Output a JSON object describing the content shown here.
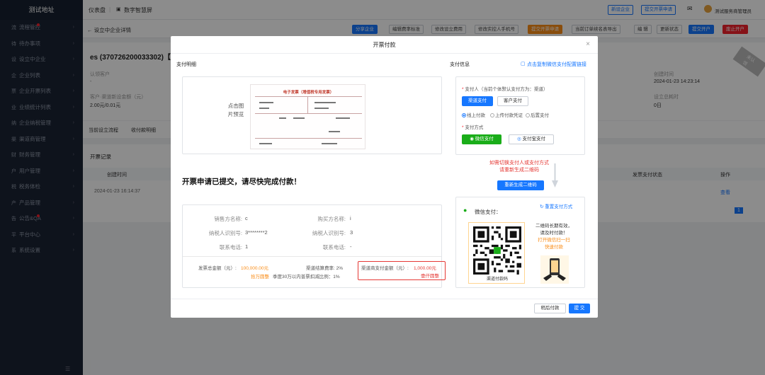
{
  "sidebar": {
    "logo": "测试地址",
    "items": [
      {
        "icon": "流",
        "label": "流程管控",
        "dot": true
      },
      {
        "icon": "待",
        "label": "待办事项",
        "dot": false
      },
      {
        "icon": "设",
        "label": "设立中企业",
        "dot": false
      },
      {
        "icon": "企",
        "label": "企业列表",
        "dot": false
      },
      {
        "icon": "票",
        "label": "企业开票列表",
        "dot": false
      },
      {
        "icon": "业",
        "label": "业绩统计列表",
        "dot": false
      },
      {
        "icon": "纳",
        "label": "企业纳税管理",
        "dot": false
      },
      {
        "icon": "渠",
        "label": "渠道商管理",
        "dot": false
      },
      {
        "icon": "财",
        "label": "财务管理",
        "dot": false
      },
      {
        "icon": "户",
        "label": "用户管理",
        "dot": false
      },
      {
        "icon": "税",
        "label": "税务体检",
        "dot": false
      },
      {
        "icon": "产",
        "label": "产品管理",
        "dot": false
      },
      {
        "icon": "告",
        "label": "公告&QA",
        "dot": true
      },
      {
        "icon": "平",
        "label": "平台中心",
        "dot": false
      },
      {
        "icon": "系",
        "label": "系统设置",
        "dot": false
      }
    ],
    "collapse_icon": "☰"
  },
  "topbar": {
    "tab1": "仪表盘",
    "tab2": "数字智慧屏",
    "btn_new_company": "新设企业",
    "btn_invoice_apply": "提交开票申请",
    "user": "测试服务商管理员"
  },
  "pagebar": {
    "back": "← 设立中企业详情",
    "buttons": [
      "分享企业",
      "编辑费率标准",
      "修改设立费用",
      "修改实控人手机号",
      "提交开票申请",
      "当前订单续名表导出",
      "编 辑",
      "更新状态",
      "提交开户",
      "废止开户"
    ]
  },
  "background": {
    "company_title": "es (370726200033302)【待",
    "ribbon": "未认领",
    "label_customer": "认领客户",
    "val_customer": "-",
    "label_fee": "客户·渠道新设金额（元）",
    "val_fee": "2.00元/0.01元",
    "label_created": "创建时间",
    "val_created": "2024-01-23 14:23:14",
    "label_setup_time": "设立总耗时",
    "val_setup_time": "0日",
    "tabs": [
      "当前设立流程",
      "收付款明细"
    ],
    "records_title": "开票记录",
    "col_created": "创建时间",
    "col_pay_status": "发票支付状态",
    "col_action": "操作",
    "row_time": "2024-01-23 16:14:37",
    "row_action": "查看",
    "page_num": "1"
  },
  "modal": {
    "title": "开票付款",
    "close": "×",
    "left_label": "支付明细",
    "right_label": "支付信息",
    "copy_link": "点击复制微信支付配置链接",
    "invoice_hint": "点击图片预览",
    "invoice_title": "电子发票（增值税专用发票）",
    "submit_msg": "开票申请已提交，请尽快完成付款！",
    "seller_name_label": "销售方名称:",
    "seller_name_val": "c",
    "buyer_name_label": "购买方名称:",
    "buyer_name_val": "i",
    "seller_tax_label": "纳税人识别号:",
    "seller_tax_val": "3********2",
    "buyer_tax_label": "纳税人识别号:",
    "buyer_tax_val": "3",
    "seller_phone_label": "联系电话:",
    "seller_phone_val": "1",
    "buyer_phone_label": "联系电话:",
    "buyer_phone_val": "-",
    "total_label": "发票总金额（元）:",
    "total_val": "100,000.00元",
    "total_cn": "拾万圆整",
    "channel_rate": "渠道结算费率: 2%",
    "quarter_ratio": "季度30万以内普票扣减比例：1%",
    "pay_amount_label": "渠道商支付金额（元）:",
    "pay_amount_val": "1,000.00元",
    "pay_amount_cn": "壹仟圆整",
    "payer_label": "支付人（当前个体默认支付方为：渠道）",
    "btn_channel_pay": "渠道支付",
    "btn_customer_pay": "客户支付",
    "radio_online": "线上付款",
    "radio_upload": "上传付款凭证",
    "radio_later": "后置支付",
    "method_label": "支付方式",
    "btn_wechat": "微信支付",
    "btn_alipay": "支付宝支付",
    "tip_red_1": "如需切换支付人或支付方式",
    "tip_red_2": "请重新生成二维码",
    "btn_regen": "重新生成二维码",
    "wechat_label": "微信支付：",
    "reset_method": "重置支付方式",
    "qr_caption": "渠道付款码",
    "qr_tip_1": "二维码长期有效，",
    "qr_tip_2": "请及时付款！",
    "qr_tip_3": "打开微信扫一扫",
    "qr_tip_4": "快速付款",
    "btn_pay_later": "稍后付款",
    "btn_submit": "提 交"
  }
}
